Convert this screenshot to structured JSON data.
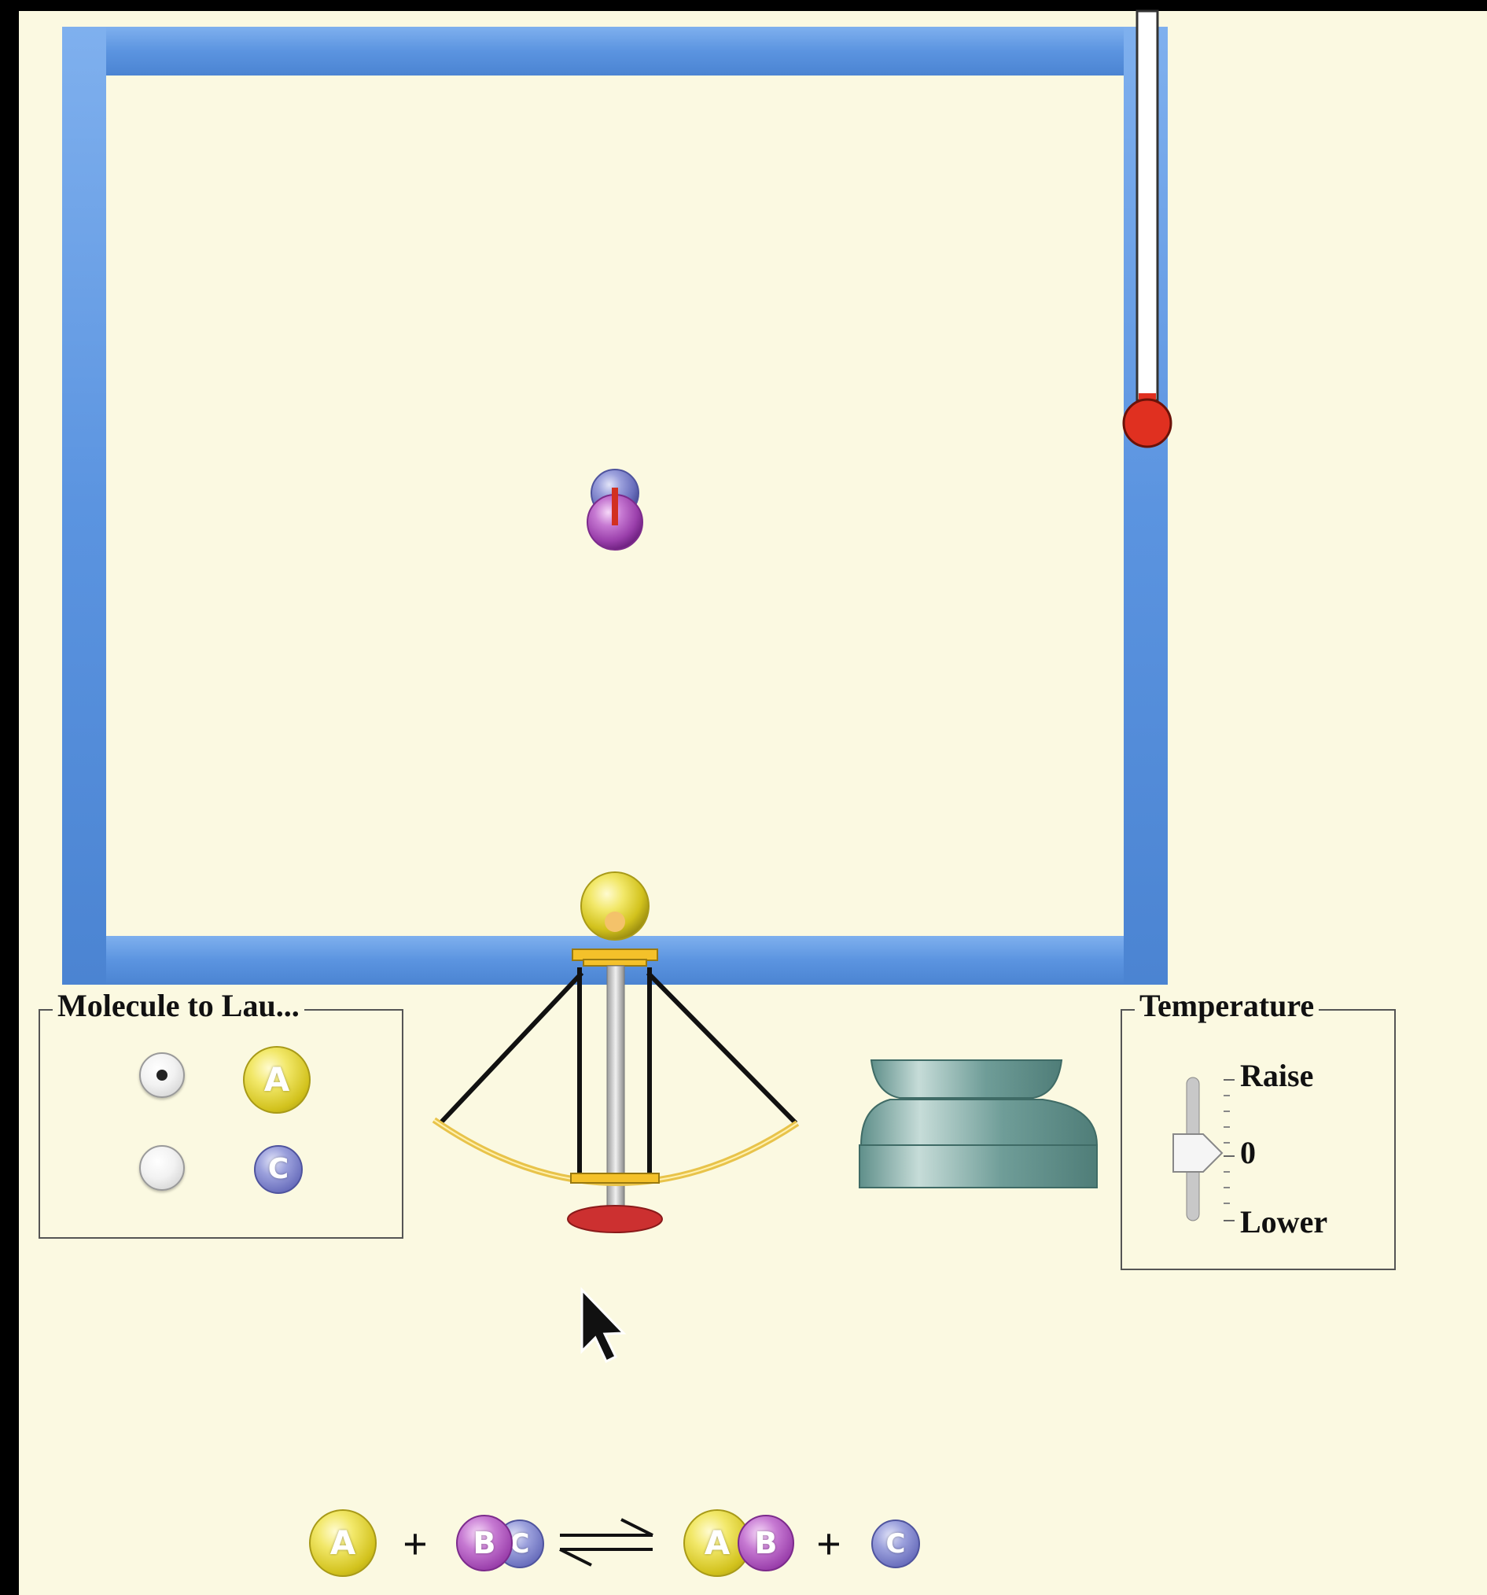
{
  "molecule_panel": {
    "title": "Molecule to Lau...",
    "options": [
      {
        "label": "A",
        "selected": true
      },
      {
        "label": "C",
        "selected": false
      }
    ]
  },
  "temperature_panel": {
    "title": "Temperature",
    "labels": {
      "raise": "Raise",
      "zero": "0",
      "lower": "Lower"
    },
    "slider_value": 0
  },
  "reaction": {
    "reactant_1": "A",
    "plus_1": "+",
    "reactant_2_a": "B",
    "reactant_2_b": "C",
    "product_1_a": "A",
    "product_1_b": "B",
    "plus_2": "+",
    "product_2": "C"
  },
  "colors": {
    "box_wall": "#5b94e0",
    "background": "#fbf9e1",
    "molecule_a": "#e4d43a",
    "molecule_b": "#a84cc0",
    "molecule_c": "#7479c4",
    "thermometer_bulb": "#e03020"
  },
  "icons": {
    "launcher": "molecule-launcher-icon",
    "pump": "heater-cooler-icon",
    "cursor": "mouse-pointer-icon",
    "thermometer": "thermometer-icon",
    "equilibrium": "equilibrium-arrows-icon"
  }
}
